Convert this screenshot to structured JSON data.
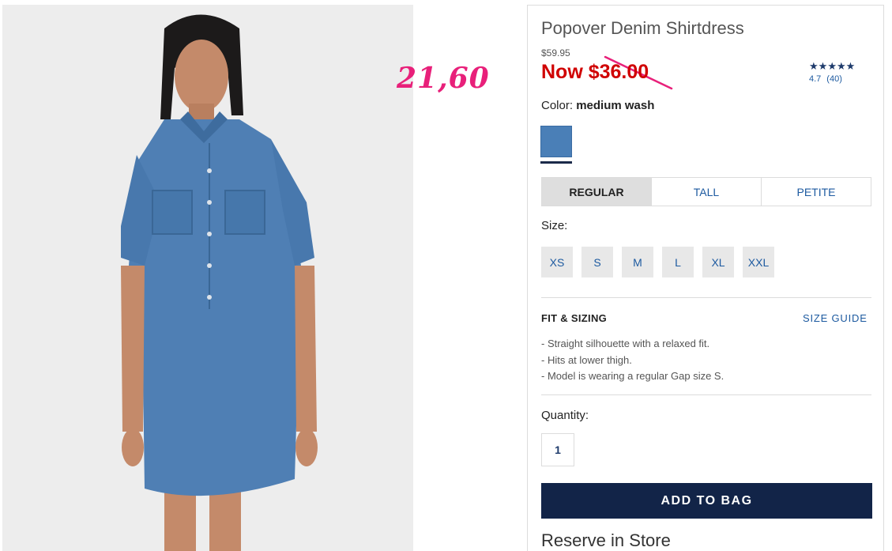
{
  "product": {
    "title": "Popover Denim Shirtdress",
    "original_price": "$59.95",
    "now_price": "Now $36.00",
    "handwritten_price": "21,60",
    "rating": {
      "stars": 5,
      "score": "4.7",
      "count": "(40)"
    },
    "color": {
      "label": "Color:",
      "value": "medium wash",
      "swatch_color": "#4a7fb7"
    },
    "fit_tabs": [
      {
        "label": "REGULAR",
        "active": true
      },
      {
        "label": "TALL",
        "active": false
      },
      {
        "label": "PETITE",
        "active": false
      }
    ],
    "size_label": "Size:",
    "sizes": [
      "XS",
      "S",
      "M",
      "L",
      "XL",
      "XXL"
    ],
    "fit_sizing": {
      "heading": "FIT & SIZING",
      "guide_link": "SIZE GUIDE",
      "notes": [
        "- Straight silhouette with a relaxed fit.",
        "- Hits at lower thigh.",
        "- Model is wearing a regular Gap size S."
      ]
    },
    "quantity": {
      "label": "Quantity:",
      "value": "1"
    },
    "add_to_bag": "ADD TO BAG",
    "reserve": "Reserve in Store"
  },
  "colors": {
    "sale_red": "#d00000",
    "brand_navy": "#122448",
    "link_blue": "#1d5aa0",
    "annotation_pink": "#e8207a"
  }
}
